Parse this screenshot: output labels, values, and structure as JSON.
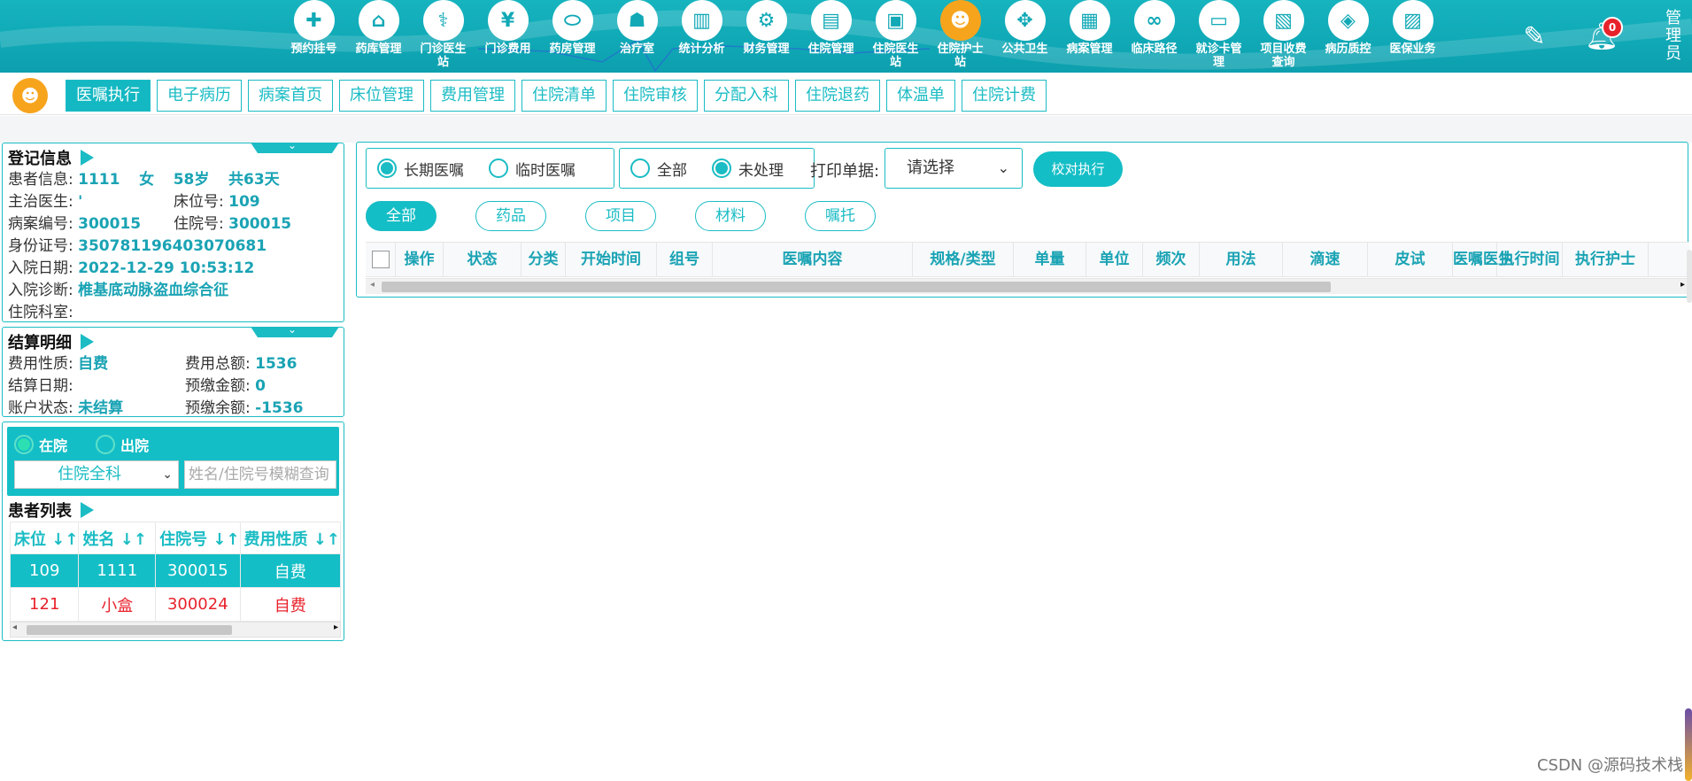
{
  "nav": [
    {
      "icon": "calendar-add-icon",
      "glyph": "✚",
      "label": "预约挂号",
      "active": false
    },
    {
      "icon": "pharmacy-house-icon",
      "glyph": "⌂",
      "label": "药库管理",
      "active": false
    },
    {
      "icon": "doctor-icon",
      "glyph": "⚕",
      "label": "门诊医生站",
      "active": false
    },
    {
      "icon": "yen-icon",
      "glyph": "¥",
      "label": "门诊费用",
      "active": false
    },
    {
      "icon": "pill-icon",
      "glyph": "⬭",
      "label": "药房管理",
      "active": false
    },
    {
      "icon": "nurse-icon",
      "glyph": "☗",
      "label": "治疗室",
      "active": false
    },
    {
      "icon": "bar-chart-icon",
      "glyph": "▥",
      "label": "统计分析",
      "active": false
    },
    {
      "icon": "gear-icon",
      "glyph": "⚙",
      "label": "财务管理",
      "active": false
    },
    {
      "icon": "bed-icon",
      "glyph": "▤",
      "label": "住院管理",
      "active": false
    },
    {
      "icon": "inpatient-doctor-icon",
      "glyph": "▣",
      "label": "住院医生站",
      "active": false
    },
    {
      "icon": "inpatient-nurse-icon",
      "glyph": "☻",
      "label": "住院护士站",
      "active": true
    },
    {
      "icon": "public-health-icon",
      "glyph": "✥",
      "label": "公共卫生",
      "active": false
    },
    {
      "icon": "records-icon",
      "glyph": "▦",
      "label": "病案管理",
      "active": false
    },
    {
      "icon": "clinical-path-icon",
      "glyph": "∞",
      "label": "临床路径",
      "active": false
    },
    {
      "icon": "card-icon",
      "glyph": "▭",
      "label": "就诊卡管理",
      "active": false
    },
    {
      "icon": "fee-query-icon",
      "glyph": "▧",
      "label": "项目收费查询",
      "active": false
    },
    {
      "icon": "quality-icon",
      "glyph": "◈",
      "label": "病历质控",
      "active": false
    },
    {
      "icon": "insurance-icon",
      "glyph": "▨",
      "label": "医保业务",
      "active": false
    }
  ],
  "topbar": {
    "pen_icon": "pencil-icon",
    "notify_count": "0",
    "admin": "管理员"
  },
  "tabs": [
    "医嘱执行",
    "电子病历",
    "病案首页",
    "床位管理",
    "费用管理",
    "住院清单",
    "住院审核",
    "分配入科",
    "住院退药",
    "体温单",
    "住院计费"
  ],
  "registration": {
    "title": "登记信息",
    "patient_label": "患者信息:",
    "patient_id": "1111",
    "sex": "女",
    "age": "58岁",
    "days": "共63天",
    "doctor_label": "主治医生:",
    "doctor": "'",
    "bed_label": "床位号:",
    "bed": "109",
    "case_label": "病案编号:",
    "case_no": "300015",
    "inpatient_label": "住院号:",
    "inpatient_no": "300015",
    "idcard_label": "身份证号:",
    "idcard": "350781196403070681",
    "admit_label": "入院日期:",
    "admit_date": "2022-12-29 10:53:12",
    "diag_label": "入院诊断:",
    "diagnosis": "椎基底动脉盗血综合征",
    "dept_label": "住院科室:",
    "dept": ""
  },
  "settlement": {
    "title": "结算明细",
    "fee_type_label": "费用性质:",
    "fee_type": "自费",
    "total_label": "费用总额:",
    "total": "1536",
    "date_label": "结算日期:",
    "date": "",
    "prepaid_label": "预缴金额:",
    "prepaid": "0",
    "status_label": "账户状态:",
    "status": "未结算",
    "balance_label": "预缴余额:",
    "balance": "-1536"
  },
  "filter": {
    "in_label": "在院",
    "out_label": "出院",
    "dept_select": "住院全科",
    "search_placeholder": "姓名/住院号模糊查询"
  },
  "patient_list": {
    "title": "患者列表",
    "headers": [
      "床位",
      "姓名",
      "住院号",
      "费用性质"
    ],
    "rows": [
      {
        "bed": "109",
        "name": "1111",
        "no": "300015",
        "fee": "自费"
      },
      {
        "bed": "121",
        "name": "小盒",
        "no": "300024",
        "fee": "自费"
      }
    ]
  },
  "orders": {
    "long_term": "长期医嘱",
    "temporary": "临时医嘱",
    "all": "全部",
    "unprocessed": "未处理",
    "print_label": "打印单据:",
    "print_select": "请选择",
    "exec_button": "校对执行",
    "pills": [
      "全部",
      "药品",
      "项目",
      "材料",
      "嘱托"
    ],
    "columns": [
      "操作",
      "状态",
      "分类",
      "开始时间",
      "组号",
      "医嘱内容",
      "规格/类型",
      "单量",
      "单位",
      "频次",
      "用法",
      "滴速",
      "皮试",
      "医嘱医生",
      "执行时间",
      "执行护士"
    ]
  },
  "watermark": "CSDN @源码技术栈",
  "colors": {
    "accent": "#14bec6",
    "active_nav": "#f7a41d",
    "alert": "#e8222b"
  }
}
